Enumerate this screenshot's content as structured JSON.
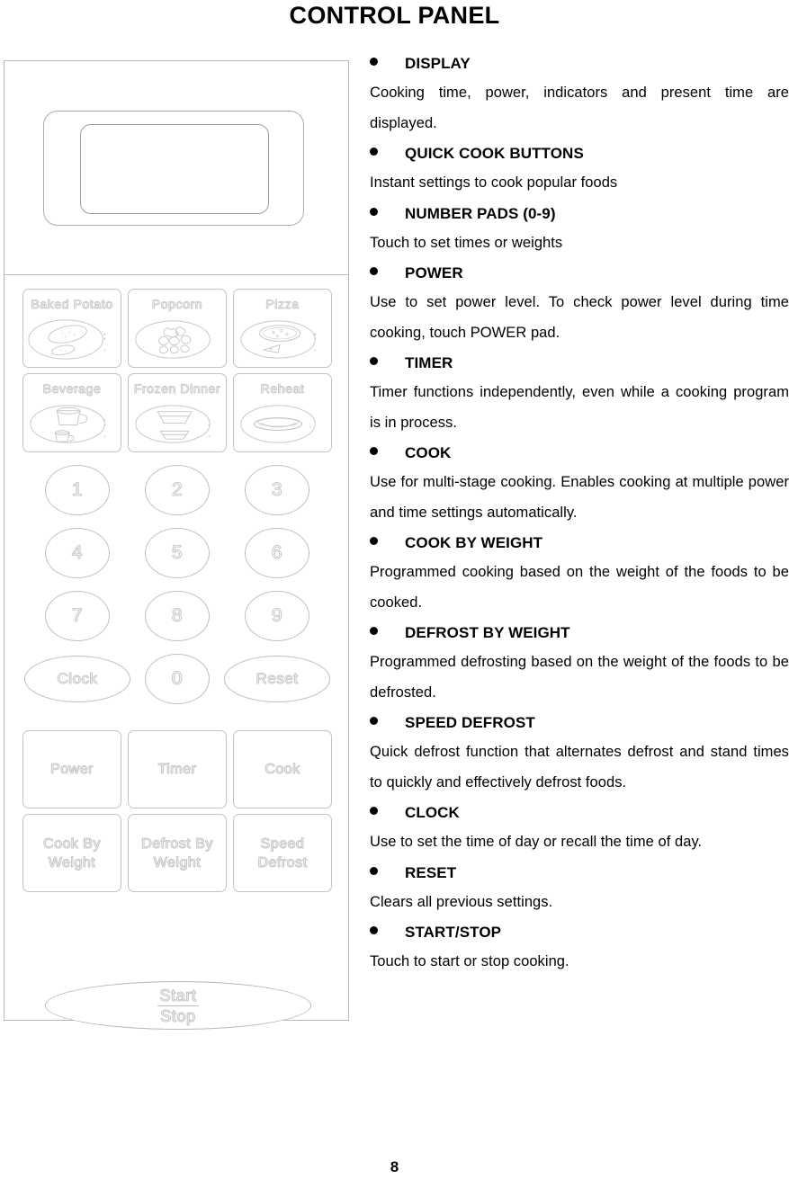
{
  "document": {
    "title": "CONTROL PANEL",
    "page_number": "8"
  },
  "control_panel_diagram": {
    "display_window": {
      "name": "display-window",
      "label": ""
    },
    "quick_cook_buttons": [
      {
        "label": "Baked Potato",
        "icon": "baked-potato-icon"
      },
      {
        "label": "Popcorn",
        "icon": "popcorn-icon"
      },
      {
        "label": "Pizza",
        "icon": "pizza-icon"
      },
      {
        "label": "Beverage",
        "icon": "beverage-icon"
      },
      {
        "label": "Frozen Dinner",
        "icon": "frozen-dinner-icon"
      },
      {
        "label": "Reheat",
        "icon": "reheat-icon"
      }
    ],
    "number_pads": [
      {
        "label": "1"
      },
      {
        "label": "2"
      },
      {
        "label": "3"
      },
      {
        "label": "4"
      },
      {
        "label": "5"
      },
      {
        "label": "6"
      },
      {
        "label": "7"
      },
      {
        "label": "8"
      },
      {
        "label": "9"
      },
      {
        "label": "Clock"
      },
      {
        "label": "0"
      },
      {
        "label": "Reset"
      }
    ],
    "function_buttons": [
      {
        "label": "Power"
      },
      {
        "label": "Timer"
      },
      {
        "label": "Cook"
      },
      {
        "label": "Cook By\nWeight"
      },
      {
        "label": "Defrost By\nWeight"
      },
      {
        "label": "Speed\nDefrost"
      }
    ],
    "start_stop_button": {
      "line1": "Start",
      "line2": "Stop"
    }
  },
  "descriptions": [
    {
      "heading": "DISPLAY",
      "body": "Cooking time, power, indicators and present time are displayed.",
      "justify": true
    },
    {
      "heading": "QUICK COOK BUTTONS",
      "body": "Instant settings to cook popular foods",
      "justify": false
    },
    {
      "heading": "NUMBER PADS (0-9)",
      "body": "Touch to set times or weights",
      "justify": false
    },
    {
      "heading": "POWER",
      "body": "Use to set power level. To check power level during time cooking, touch POWER pad.",
      "justify": true
    },
    {
      "heading": "TIMER",
      "body": "Timer functions independently, even while a cooking program is in process.",
      "justify": true
    },
    {
      "heading": "COOK",
      "body": "Use for multi-stage cooking.   Enables cooking at multiple power and time settings automatically.",
      "justify": true
    },
    {
      "heading": "COOK BY WEIGHT",
      "body": "Programmed cooking based on the weight of the foods to be cooked.",
      "justify": true
    },
    {
      "heading": "DEFROST BY WEIGHT",
      "body": "Programmed defrosting based on the weight of the foods to be defrosted.",
      "justify": true
    },
    {
      "heading": "SPEED DEFROST",
      "body": "Quick defrost function that alternates defrost and stand times to quickly and effectively defrost foods.",
      "justify": true
    },
    {
      "heading": "CLOCK",
      "body": "Use to set the time of day or recall the time of day.",
      "justify": false
    },
    {
      "heading": "RESET",
      "body": "Clears all previous settings.",
      "justify": false
    },
    {
      "heading": "START/STOP",
      "body": "Touch to start or stop cooking.",
      "justify": false
    }
  ]
}
